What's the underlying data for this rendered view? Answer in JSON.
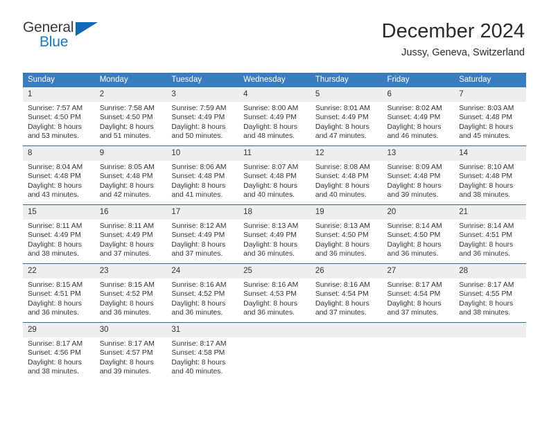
{
  "brand": {
    "name_top": "General",
    "name_bottom": "Blue",
    "triangle_color": "#1268b3",
    "blue": "#1f77c4"
  },
  "header": {
    "title": "December 2024",
    "subtitle": "Jussy, Geneva, Switzerland",
    "header_bg": "#3a7cc0",
    "row_divider": "#2e6ca8",
    "daynum_bg": "#eeeeee"
  },
  "weekdays": [
    "Sunday",
    "Monday",
    "Tuesday",
    "Wednesday",
    "Thursday",
    "Friday",
    "Saturday"
  ],
  "labels": {
    "sunrise_prefix": "Sunrise:",
    "sunset_prefix": "Sunset:",
    "daylight_prefix": "Daylight:"
  },
  "weeks": [
    [
      {
        "day": "1",
        "sunrise": "Sunrise: 7:57 AM",
        "sunset": "Sunset: 4:50 PM",
        "daylight_1": "Daylight: 8 hours",
        "daylight_2": "and 53 minutes."
      },
      {
        "day": "2",
        "sunrise": "Sunrise: 7:58 AM",
        "sunset": "Sunset: 4:50 PM",
        "daylight_1": "Daylight: 8 hours",
        "daylight_2": "and 51 minutes."
      },
      {
        "day": "3",
        "sunrise": "Sunrise: 7:59 AM",
        "sunset": "Sunset: 4:49 PM",
        "daylight_1": "Daylight: 8 hours",
        "daylight_2": "and 50 minutes."
      },
      {
        "day": "4",
        "sunrise": "Sunrise: 8:00 AM",
        "sunset": "Sunset: 4:49 PM",
        "daylight_1": "Daylight: 8 hours",
        "daylight_2": "and 48 minutes."
      },
      {
        "day": "5",
        "sunrise": "Sunrise: 8:01 AM",
        "sunset": "Sunset: 4:49 PM",
        "daylight_1": "Daylight: 8 hours",
        "daylight_2": "and 47 minutes."
      },
      {
        "day": "6",
        "sunrise": "Sunrise: 8:02 AM",
        "sunset": "Sunset: 4:49 PM",
        "daylight_1": "Daylight: 8 hours",
        "daylight_2": "and 46 minutes."
      },
      {
        "day": "7",
        "sunrise": "Sunrise: 8:03 AM",
        "sunset": "Sunset: 4:48 PM",
        "daylight_1": "Daylight: 8 hours",
        "daylight_2": "and 45 minutes."
      }
    ],
    [
      {
        "day": "8",
        "sunrise": "Sunrise: 8:04 AM",
        "sunset": "Sunset: 4:48 PM",
        "daylight_1": "Daylight: 8 hours",
        "daylight_2": "and 43 minutes."
      },
      {
        "day": "9",
        "sunrise": "Sunrise: 8:05 AM",
        "sunset": "Sunset: 4:48 PM",
        "daylight_1": "Daylight: 8 hours",
        "daylight_2": "and 42 minutes."
      },
      {
        "day": "10",
        "sunrise": "Sunrise: 8:06 AM",
        "sunset": "Sunset: 4:48 PM",
        "daylight_1": "Daylight: 8 hours",
        "daylight_2": "and 41 minutes."
      },
      {
        "day": "11",
        "sunrise": "Sunrise: 8:07 AM",
        "sunset": "Sunset: 4:48 PM",
        "daylight_1": "Daylight: 8 hours",
        "daylight_2": "and 40 minutes."
      },
      {
        "day": "12",
        "sunrise": "Sunrise: 8:08 AM",
        "sunset": "Sunset: 4:48 PM",
        "daylight_1": "Daylight: 8 hours",
        "daylight_2": "and 40 minutes."
      },
      {
        "day": "13",
        "sunrise": "Sunrise: 8:09 AM",
        "sunset": "Sunset: 4:48 PM",
        "daylight_1": "Daylight: 8 hours",
        "daylight_2": "and 39 minutes."
      },
      {
        "day": "14",
        "sunrise": "Sunrise: 8:10 AM",
        "sunset": "Sunset: 4:48 PM",
        "daylight_1": "Daylight: 8 hours",
        "daylight_2": "and 38 minutes."
      }
    ],
    [
      {
        "day": "15",
        "sunrise": "Sunrise: 8:11 AM",
        "sunset": "Sunset: 4:49 PM",
        "daylight_1": "Daylight: 8 hours",
        "daylight_2": "and 38 minutes."
      },
      {
        "day": "16",
        "sunrise": "Sunrise: 8:11 AM",
        "sunset": "Sunset: 4:49 PM",
        "daylight_1": "Daylight: 8 hours",
        "daylight_2": "and 37 minutes."
      },
      {
        "day": "17",
        "sunrise": "Sunrise: 8:12 AM",
        "sunset": "Sunset: 4:49 PM",
        "daylight_1": "Daylight: 8 hours",
        "daylight_2": "and 37 minutes."
      },
      {
        "day": "18",
        "sunrise": "Sunrise: 8:13 AM",
        "sunset": "Sunset: 4:49 PM",
        "daylight_1": "Daylight: 8 hours",
        "daylight_2": "and 36 minutes."
      },
      {
        "day": "19",
        "sunrise": "Sunrise: 8:13 AM",
        "sunset": "Sunset: 4:50 PM",
        "daylight_1": "Daylight: 8 hours",
        "daylight_2": "and 36 minutes."
      },
      {
        "day": "20",
        "sunrise": "Sunrise: 8:14 AM",
        "sunset": "Sunset: 4:50 PM",
        "daylight_1": "Daylight: 8 hours",
        "daylight_2": "and 36 minutes."
      },
      {
        "day": "21",
        "sunrise": "Sunrise: 8:14 AM",
        "sunset": "Sunset: 4:51 PM",
        "daylight_1": "Daylight: 8 hours",
        "daylight_2": "and 36 minutes."
      }
    ],
    [
      {
        "day": "22",
        "sunrise": "Sunrise: 8:15 AM",
        "sunset": "Sunset: 4:51 PM",
        "daylight_1": "Daylight: 8 hours",
        "daylight_2": "and 36 minutes."
      },
      {
        "day": "23",
        "sunrise": "Sunrise: 8:15 AM",
        "sunset": "Sunset: 4:52 PM",
        "daylight_1": "Daylight: 8 hours",
        "daylight_2": "and 36 minutes."
      },
      {
        "day": "24",
        "sunrise": "Sunrise: 8:16 AM",
        "sunset": "Sunset: 4:52 PM",
        "daylight_1": "Daylight: 8 hours",
        "daylight_2": "and 36 minutes."
      },
      {
        "day": "25",
        "sunrise": "Sunrise: 8:16 AM",
        "sunset": "Sunset: 4:53 PM",
        "daylight_1": "Daylight: 8 hours",
        "daylight_2": "and 36 minutes."
      },
      {
        "day": "26",
        "sunrise": "Sunrise: 8:16 AM",
        "sunset": "Sunset: 4:54 PM",
        "daylight_1": "Daylight: 8 hours",
        "daylight_2": "and 37 minutes."
      },
      {
        "day": "27",
        "sunrise": "Sunrise: 8:17 AM",
        "sunset": "Sunset: 4:54 PM",
        "daylight_1": "Daylight: 8 hours",
        "daylight_2": "and 37 minutes."
      },
      {
        "day": "28",
        "sunrise": "Sunrise: 8:17 AM",
        "sunset": "Sunset: 4:55 PM",
        "daylight_1": "Daylight: 8 hours",
        "daylight_2": "and 38 minutes."
      }
    ],
    [
      {
        "day": "29",
        "sunrise": "Sunrise: 8:17 AM",
        "sunset": "Sunset: 4:56 PM",
        "daylight_1": "Daylight: 8 hours",
        "daylight_2": "and 38 minutes."
      },
      {
        "day": "30",
        "sunrise": "Sunrise: 8:17 AM",
        "sunset": "Sunset: 4:57 PM",
        "daylight_1": "Daylight: 8 hours",
        "daylight_2": "and 39 minutes."
      },
      {
        "day": "31",
        "sunrise": "Sunrise: 8:17 AM",
        "sunset": "Sunset: 4:58 PM",
        "daylight_1": "Daylight: 8 hours",
        "daylight_2": "and 40 minutes."
      },
      {
        "day": "",
        "sunrise": "",
        "sunset": "",
        "daylight_1": "",
        "daylight_2": ""
      },
      {
        "day": "",
        "sunrise": "",
        "sunset": "",
        "daylight_1": "",
        "daylight_2": ""
      },
      {
        "day": "",
        "sunrise": "",
        "sunset": "",
        "daylight_1": "",
        "daylight_2": ""
      },
      {
        "day": "",
        "sunrise": "",
        "sunset": "",
        "daylight_1": "",
        "daylight_2": ""
      }
    ]
  ]
}
